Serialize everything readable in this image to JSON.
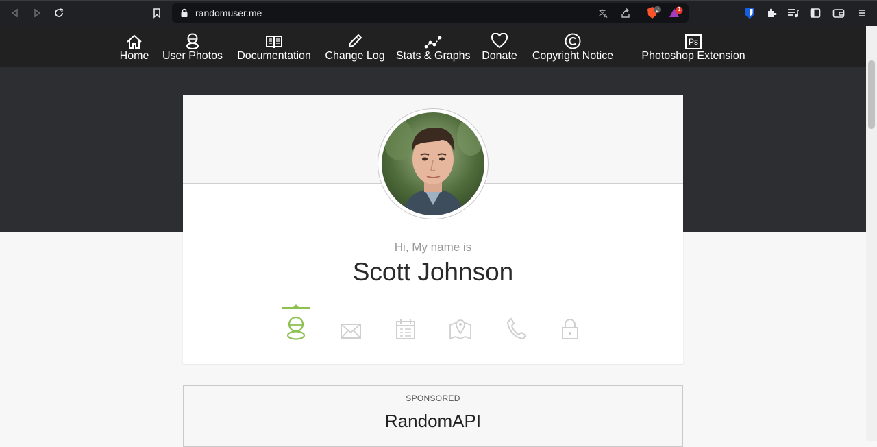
{
  "browser": {
    "url": "randomuser.me",
    "badge_brave": "2",
    "badge_alert": "1"
  },
  "nav": {
    "items": [
      {
        "label": "Home",
        "icon": "home-icon"
      },
      {
        "label": "User Photos",
        "icon": "user-icon"
      },
      {
        "label": "Documentation",
        "icon": "book-icon"
      },
      {
        "label": "Change Log",
        "icon": "pencil-icon"
      },
      {
        "label": "Stats & Graphs",
        "icon": "graph-icon"
      },
      {
        "label": "Donate",
        "icon": "heart-icon"
      },
      {
        "label": "Copyright Notice",
        "icon": "copyright-icon"
      },
      {
        "label": "Photoshop Extension",
        "icon": "photoshop-icon",
        "icon_text": "Ps"
      }
    ]
  },
  "profile": {
    "greeting": "Hi, My name is",
    "name": "Scott Johnson",
    "tabs": [
      "user-icon",
      "envelope-icon",
      "calendar-icon",
      "map-icon",
      "phone-icon",
      "lock-icon"
    ],
    "active_tab": "user-icon"
  },
  "sponsored": {
    "label": "SPONSORED",
    "title": "RandomAPI"
  },
  "colors": {
    "accent": "#8cc152",
    "nav_bg": "#212121",
    "band_bg": "#2d2e32"
  }
}
